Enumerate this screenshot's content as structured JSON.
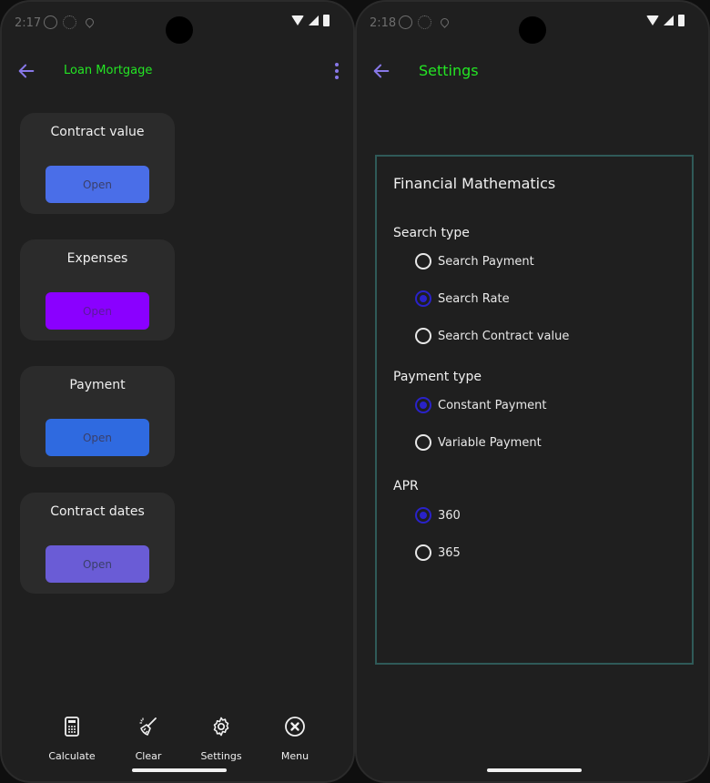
{
  "left_screen": {
    "status": {
      "time": "2:17"
    },
    "appbar": {
      "title": "Loan Mortgage"
    },
    "cards": [
      {
        "title": "Contract value",
        "button_label": "Open",
        "button_color": "#4a6ee8"
      },
      {
        "title": "Expenses",
        "button_label": "Open",
        "button_color": "#8a00ff"
      },
      {
        "title": "Payment",
        "button_label": "Open",
        "button_color": "#2f6ae0"
      },
      {
        "title": "Contract dates",
        "button_label": "Open",
        "button_color": "#6a5cd6"
      }
    ],
    "bottom_nav": [
      {
        "label": "Calculate",
        "icon": "calculator-icon"
      },
      {
        "label": "Clear",
        "icon": "broom-icon"
      },
      {
        "label": "Settings",
        "icon": "gear-icon"
      },
      {
        "label": "Menu",
        "icon": "close-circle-icon"
      }
    ]
  },
  "right_screen": {
    "status": {
      "time": "2:18"
    },
    "appbar": {
      "title": "Settings"
    },
    "panel": {
      "heading": "Financial Mathematics",
      "search_type": {
        "label": "Search type",
        "options": [
          "Search Payment",
          "Search Rate",
          "Search Contract value"
        ],
        "selected": "Search Rate"
      },
      "payment_type": {
        "label": "Payment type",
        "options": [
          "Constant Payment",
          "Variable Payment"
        ],
        "selected": "Constant Payment"
      },
      "apr": {
        "label": "APR",
        "options": [
          "360",
          "365"
        ],
        "selected": "360"
      }
    }
  },
  "colors": {
    "title_green": "#24e524",
    "accent_purple": "#8878e8",
    "radio_selected": "#2a22c9",
    "panel_border": "#2f5a58"
  }
}
